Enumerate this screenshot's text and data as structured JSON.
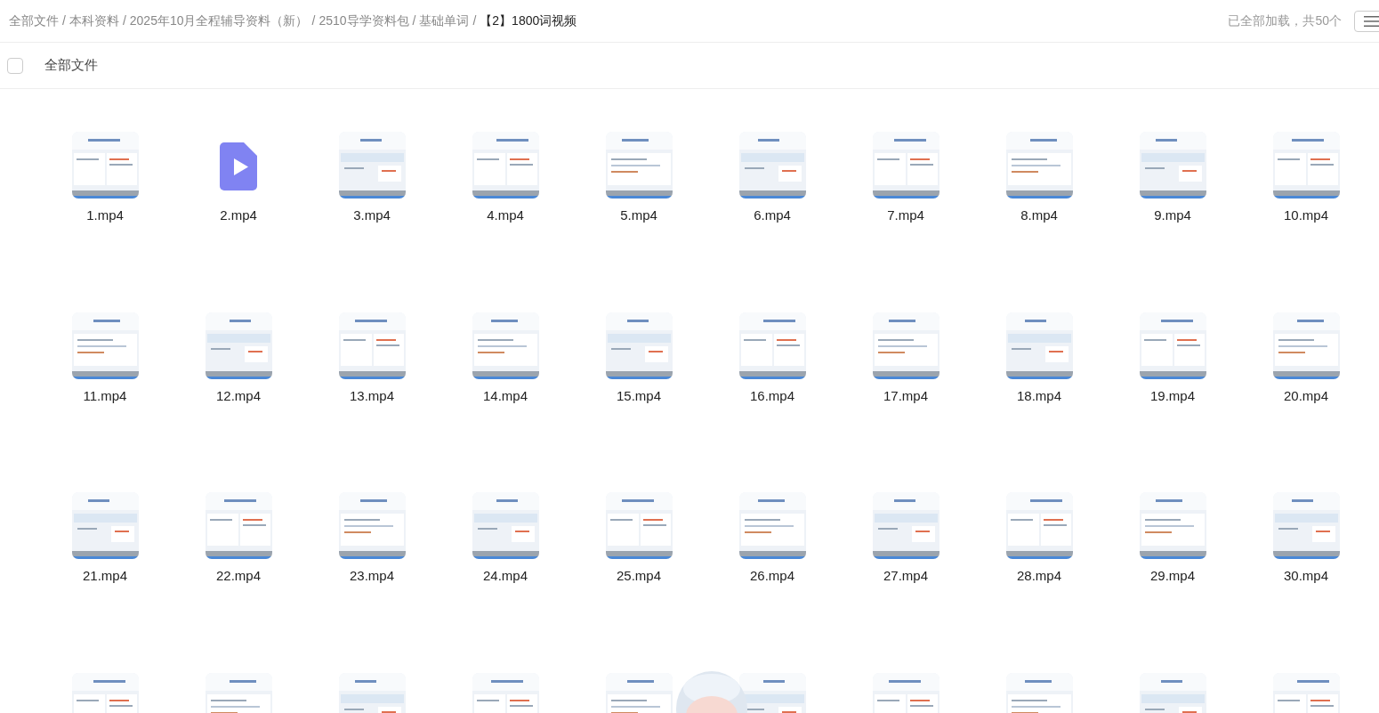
{
  "breadcrumb": {
    "separator": "/",
    "items": [
      {
        "label": "全部文件",
        "current": false
      },
      {
        "label": "本科资料",
        "current": false
      },
      {
        "label": "2025年10月全程辅导资料（新）",
        "current": false
      },
      {
        "label": "2510导学资料包",
        "current": false
      },
      {
        "label": "基础单词",
        "current": false
      },
      {
        "label": "【2】1800词视频",
        "current": true
      }
    ]
  },
  "load_status": "已全部加载，共50个",
  "select_all": {
    "label": "全部文件",
    "checked": false
  },
  "files": [
    {
      "name": "1.mp4",
      "kind": "video"
    },
    {
      "name": "2.mp4",
      "kind": "icon"
    },
    {
      "name": "3.mp4",
      "kind": "video"
    },
    {
      "name": "4.mp4",
      "kind": "video"
    },
    {
      "name": "5.mp4",
      "kind": "video"
    },
    {
      "name": "6.mp4",
      "kind": "video"
    },
    {
      "name": "7.mp4",
      "kind": "video"
    },
    {
      "name": "8.mp4",
      "kind": "video"
    },
    {
      "name": "9.mp4",
      "kind": "video"
    },
    {
      "name": "10.mp4",
      "kind": "video"
    },
    {
      "name": "11.mp4",
      "kind": "video"
    },
    {
      "name": "12.mp4",
      "kind": "video"
    },
    {
      "name": "13.mp4",
      "kind": "video"
    },
    {
      "name": "14.mp4",
      "kind": "video"
    },
    {
      "name": "15.mp4",
      "kind": "video"
    },
    {
      "name": "16.mp4",
      "kind": "video"
    },
    {
      "name": "17.mp4",
      "kind": "video"
    },
    {
      "name": "18.mp4",
      "kind": "video"
    },
    {
      "name": "19.mp4",
      "kind": "video"
    },
    {
      "name": "20.mp4",
      "kind": "video"
    },
    {
      "name": "21.mp4",
      "kind": "video"
    },
    {
      "name": "22.mp4",
      "kind": "video"
    },
    {
      "name": "23.mp4",
      "kind": "video"
    },
    {
      "name": "24.mp4",
      "kind": "video"
    },
    {
      "name": "25.mp4",
      "kind": "video"
    },
    {
      "name": "26.mp4",
      "kind": "video"
    },
    {
      "name": "27.mp4",
      "kind": "video"
    },
    {
      "name": "28.mp4",
      "kind": "video"
    },
    {
      "name": "29.mp4",
      "kind": "video"
    },
    {
      "name": "30.mp4",
      "kind": "video"
    },
    {
      "kind": "video"
    },
    {
      "kind": "video"
    },
    {
      "kind": "video"
    },
    {
      "kind": "video"
    },
    {
      "kind": "video"
    },
    {
      "kind": "video"
    },
    {
      "kind": "video"
    },
    {
      "kind": "video"
    },
    {
      "kind": "video"
    },
    {
      "kind": "video"
    }
  ]
}
